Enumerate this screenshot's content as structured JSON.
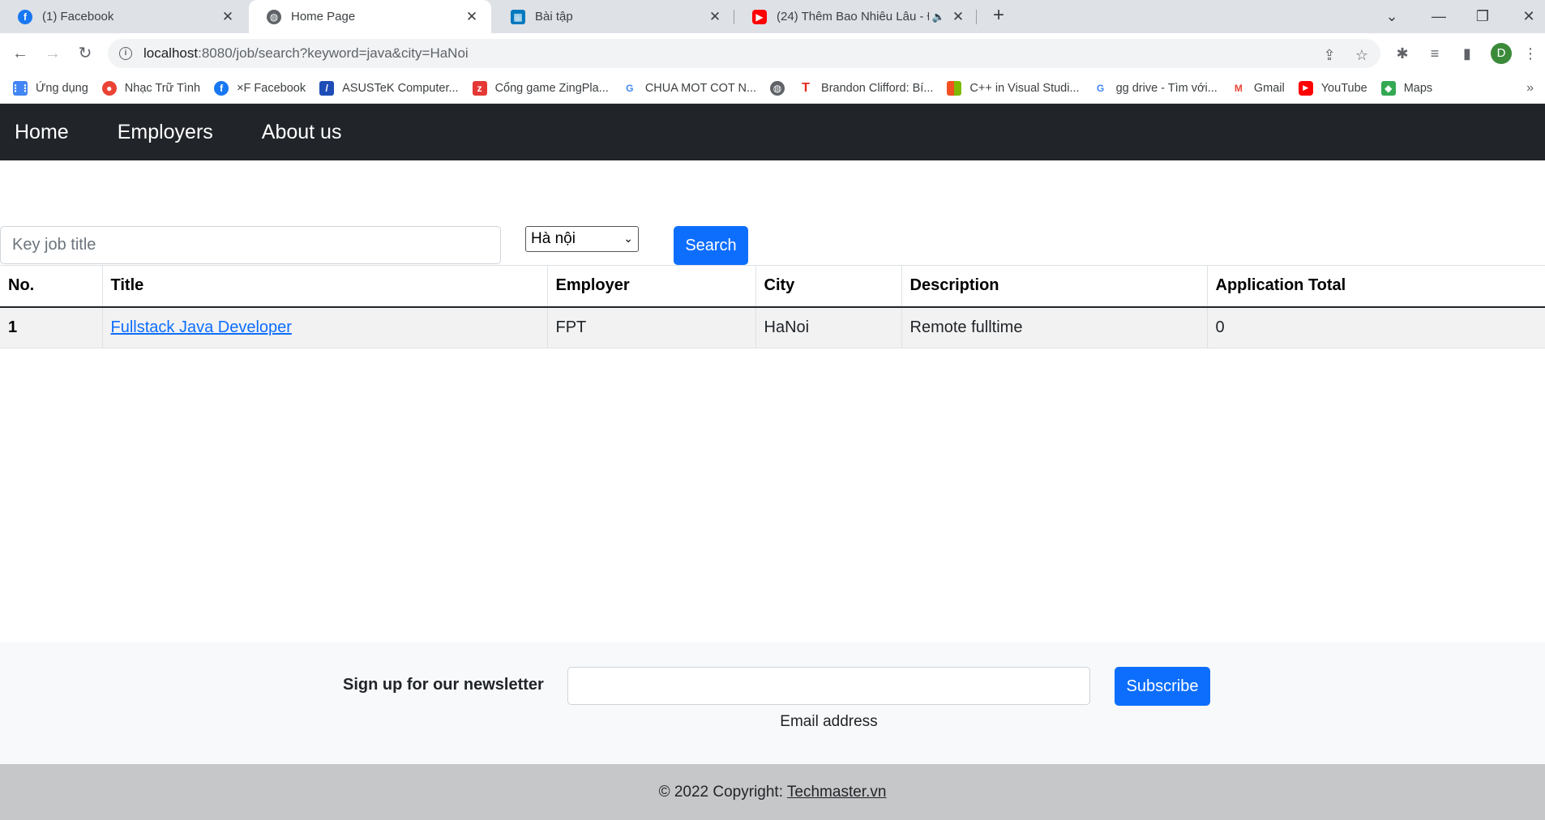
{
  "tabs": [
    {
      "title": "(1) Facebook",
      "icon": "facebook-icon",
      "color": "#1877f2"
    },
    {
      "title": "Home Page",
      "icon": "globe-icon",
      "color": "#5f6368"
    },
    {
      "title": "Bài tập",
      "icon": "trello-icon",
      "color": "#0079bf"
    },
    {
      "title": "(24) Thêm Bao Nhiêu Lâu - Đ",
      "icon": "youtube-icon",
      "color": "#ff0000"
    }
  ],
  "address": {
    "host": "localhost",
    "rest": ":8080/job/search?keyword=java&city=HaNoi"
  },
  "profile_initial": "D",
  "bookmarks": [
    {
      "label": "Ứng dụng",
      "icon": "apps-grid-icon",
      "color": "#4285f4"
    },
    {
      "label": "Nhạc Trữ Tình",
      "icon": "chrome-icon",
      "color": "#ea4335"
    },
    {
      "label": "×F Facebook",
      "icon": "facebook-icon",
      "color": "#1877f2"
    },
    {
      "label": "ASUSTeK Computer...",
      "icon": "asus-icon",
      "color": "#1e4db7"
    },
    {
      "label": "Cổng game ZingPla...",
      "icon": "zing-icon",
      "color": "#e53935"
    },
    {
      "label": "CHUA MOT COT N...",
      "icon": "google-icon",
      "color": "#4285f4"
    },
    {
      "label": "",
      "icon": "globe-icon",
      "color": "#5f6368"
    },
    {
      "label": "Brandon Clifford: Bí...",
      "icon": "ted-icon",
      "color": "#e62b1e"
    },
    {
      "label": "C++ in Visual Studi...",
      "icon": "microsoft-icon",
      "color": "#f25022"
    },
    {
      "label": "gg drive - Tìm với...",
      "icon": "google-icon",
      "color": "#4285f4"
    },
    {
      "label": "Gmail",
      "icon": "gmail-icon",
      "color": "#ea4335"
    },
    {
      "label": "YouTube",
      "icon": "youtube-icon",
      "color": "#ff0000"
    },
    {
      "label": "Maps",
      "icon": "maps-icon",
      "color": "#34a853"
    }
  ],
  "nav": {
    "home": "Home",
    "employers": "Employers",
    "about": "About us"
  },
  "search": {
    "placeholder": "Key job title",
    "city": "Hà nội",
    "button": "Search"
  },
  "table": {
    "headers": [
      "No.",
      "Title",
      "Employer",
      "City",
      "Description",
      "Application Total"
    ],
    "rows": [
      {
        "no": "1",
        "title": "Fullstack Java Developer",
        "employer": "FPT",
        "city": "HaNoi",
        "description": "Remote fulltime",
        "total": "0"
      }
    ]
  },
  "newsletter": {
    "title": "Sign up for our newsletter",
    "label": "Email address",
    "button": "Subscribe"
  },
  "footer": {
    "text": "© 2022 Copyright: ",
    "link": "Techmaster.vn"
  },
  "colors": {
    "primary": "#0d6efd",
    "navbar": "#212529",
    "footer": "#c6c7c8"
  }
}
